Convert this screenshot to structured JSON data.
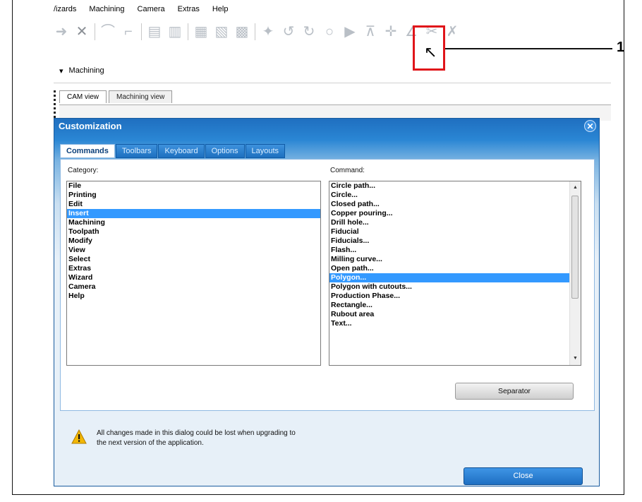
{
  "menubar": {
    "items": [
      "/izards",
      "Machining",
      "Camera",
      "Extras",
      "Help"
    ]
  },
  "ribbon": {
    "tab_label": "Machining",
    "dropdown_glyph": "▾"
  },
  "view_tabs": [
    "CAM view",
    "Machining view"
  ],
  "dialog": {
    "title": "Customization",
    "tabs": [
      "Commands",
      "Toolbars",
      "Keyboard",
      "Options",
      "Layouts"
    ],
    "category_label": "Category:",
    "command_label": "Command:",
    "categories": [
      "File",
      "Printing",
      "Edit",
      "Insert",
      "Machining",
      "Toolpath",
      "Modify",
      "View",
      "Select",
      "Extras",
      "Wizard",
      "Camera",
      "Help"
    ],
    "selected_category": "Insert",
    "commands": [
      "Circle path...",
      "Circle...",
      "Closed path...",
      "Copper pouring...",
      "Drill hole...",
      "Fiducial",
      "Fiducials...",
      "Flash...",
      "Milling curve...",
      "Open path...",
      "Polygon...",
      "Polygon with cutouts...",
      "Production Phase...",
      "Rectangle...",
      "Rubout area",
      "Text..."
    ],
    "selected_command": "Polygon...",
    "separator_label": "Separator",
    "warning_line1": "All changes made in this dialog could be lost when upgrading to",
    "warning_line2": "the next version of the application.",
    "close_label": "Close"
  },
  "callout": {
    "number": "1"
  },
  "colors": {
    "selection": "#3399ff",
    "dialog_title_bar": "#1f6fc0",
    "callout_box": "#e0151a"
  }
}
